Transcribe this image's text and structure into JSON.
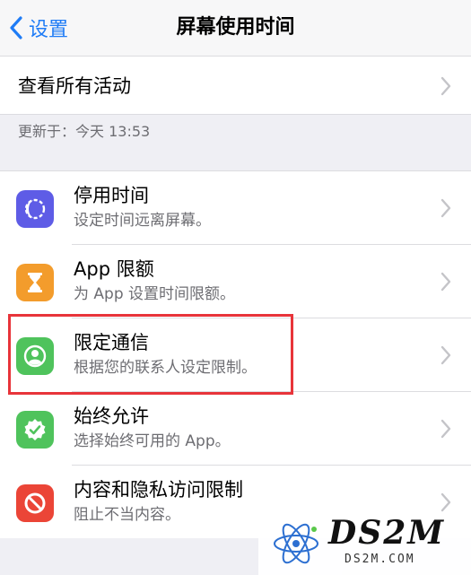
{
  "nav": {
    "back_label": "设置",
    "title": "屏幕使用时间"
  },
  "top_row": {
    "label": "查看所有活动"
  },
  "updated": "更新于：今天 13:53",
  "items": [
    {
      "title": "停用时间",
      "subtitle": "设定时间远离屏幕。",
      "icon": "downtime-icon",
      "color": "#5e5ce6"
    },
    {
      "title": "App 限额",
      "subtitle": "为 App 设置时间限额。",
      "icon": "hourglass-icon",
      "color": "#f39c2c"
    },
    {
      "title": "限定通信",
      "subtitle": "根据您的联系人设定限制。",
      "icon": "contact-icon",
      "color": "#4fc35c"
    },
    {
      "title": "始终允许",
      "subtitle": "选择始终可用的 App。",
      "icon": "checkmark-badge-icon",
      "color": "#4fc35c"
    },
    {
      "title": "内容和隐私访问限制",
      "subtitle": "阻止不当内容。",
      "icon": "restriction-icon",
      "color": "#eb4537"
    }
  ],
  "watermark": {
    "main": "DS2M",
    "sub": "DS2M.COM"
  },
  "colors": {
    "accent": "#1f7cf6",
    "highlight": "#e8343a"
  }
}
